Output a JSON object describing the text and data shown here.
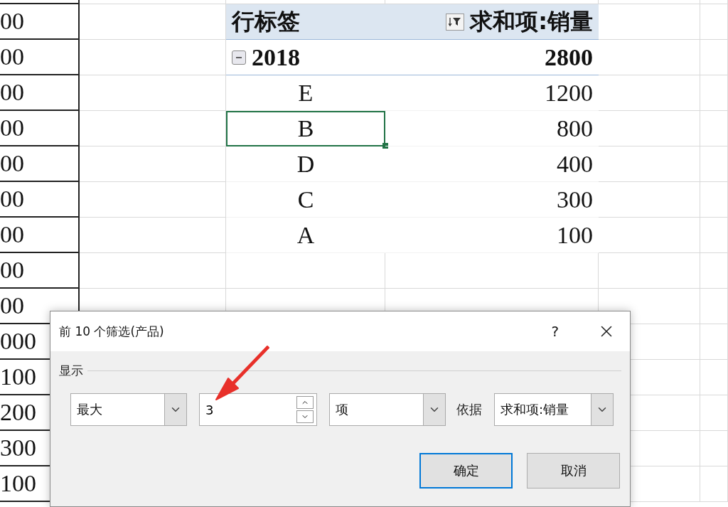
{
  "sheet": {
    "column_a": [
      "00",
      "00",
      "00",
      "00",
      "00",
      "00",
      "00",
      "00",
      "00",
      "000",
      "100",
      "200",
      "300",
      "100"
    ]
  },
  "pivot": {
    "header": {
      "row_label": "行标签",
      "value_label": "求和项:销量"
    },
    "group": {
      "label": "2018",
      "value": "2800",
      "expanded": true
    },
    "rows": [
      {
        "label": "E",
        "value": "1200",
        "selected": false
      },
      {
        "label": "B",
        "value": "800",
        "selected": true
      },
      {
        "label": "D",
        "value": "400",
        "selected": false
      },
      {
        "label": "C",
        "value": "300",
        "selected": false
      },
      {
        "label": "A",
        "value": "100",
        "selected": false
      }
    ]
  },
  "dialog": {
    "title": "前 10 个筛选(产品)",
    "help": "?",
    "section": "显示",
    "order": "最大",
    "count": "3",
    "unit": "项",
    "by_label": "依据",
    "by": "求和项:销量",
    "buttons": [
      {
        "label": "确定",
        "default": true
      },
      {
        "label": "取消",
        "default": false
      }
    ]
  }
}
